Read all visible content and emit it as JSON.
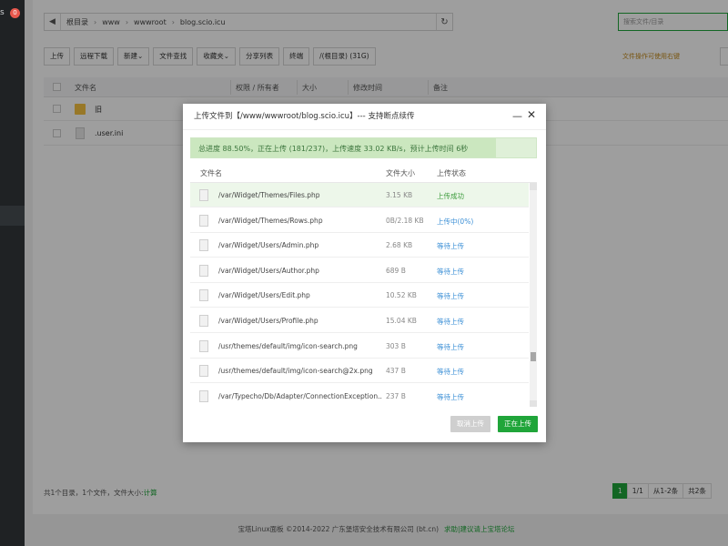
{
  "sidebar": {
    "text": "s",
    "badge": "0"
  },
  "address_bar": {
    "crumbs": [
      "根目录",
      "www",
      "wwwroot",
      "blog.scio.icu"
    ]
  },
  "search": {
    "placeholder": "搜索文件/目录"
  },
  "toolbar": {
    "buttons": [
      "上传",
      "远程下载",
      "新建⌄",
      "文件查找",
      "收藏夹⌄",
      "分享列表",
      "终端",
      "/(根目录) (31G)"
    ],
    "extra_notice": "文件操作可使用右键"
  },
  "file_table": {
    "headers": [
      "文件名",
      "权限 / 所有者",
      "大小",
      "修改时间",
      "备注"
    ],
    "rows": [
      {
        "name": "旧",
        "type": "folder"
      },
      {
        "name": ".user.ini",
        "type": "file"
      }
    ]
  },
  "footer": {
    "info": "共1个目录，1个文件，文件大小:",
    "info_link": "计算",
    "pager": [
      "1",
      "1/1",
      "从1-2条",
      "共2条"
    ]
  },
  "copyright": {
    "text": "宝塔Linux面板 ©2014-2022 广东堡塔安全技术有限公司 (bt.cn)",
    "link": "求助|建议请上宝塔论坛"
  },
  "dialog": {
    "title": "上传文件到【/www/wwwroot/blog.scio.icu】--- 支持断点续传",
    "progress_fraction": 0.885,
    "progress_text": "总进度 88.50%，正在上传 (181/237)，上传速度 33.02 KB/s，预计上传时间 6秒",
    "headers": [
      "文件名",
      "文件大小",
      "上传状态"
    ],
    "files": [
      {
        "path": "/var/Widget/Themes/Files.php",
        "size": "3.15 KB",
        "status": "上传成功",
        "state": "done"
      },
      {
        "path": "/var/Widget/Themes/Rows.php",
        "size": "0B/2.18 KB",
        "status": "上传中(0%)",
        "state": "uploading"
      },
      {
        "path": "/var/Widget/Users/Admin.php",
        "size": "2.68 KB",
        "status": "等待上传",
        "state": "waiting"
      },
      {
        "path": "/var/Widget/Users/Author.php",
        "size": "689 B",
        "status": "等待上传",
        "state": "waiting"
      },
      {
        "path": "/var/Widget/Users/Edit.php",
        "size": "10.52 KB",
        "status": "等待上传",
        "state": "waiting"
      },
      {
        "path": "/var/Widget/Users/Profile.php",
        "size": "15.04 KB",
        "status": "等待上传",
        "state": "waiting"
      },
      {
        "path": "/usr/themes/default/img/icon-search.png",
        "size": "303 B",
        "status": "等待上传",
        "state": "waiting"
      },
      {
        "path": "/usr/themes/default/img/icon-search@2x.png",
        "size": "437 B",
        "status": "等待上传",
        "state": "waiting"
      },
      {
        "path": "/var/Typecho/Db/Adapter/ConnectionException...",
        "size": "237 B",
        "status": "等待上传",
        "state": "waiting"
      }
    ],
    "cancel_label": "取消上传",
    "upload_label": "正在上传"
  },
  "colors": {
    "success": "#3c9b3c",
    "uploading": "#3b8fd6",
    "waiting": "#3b8fd6",
    "brand": "#20a53a"
  }
}
